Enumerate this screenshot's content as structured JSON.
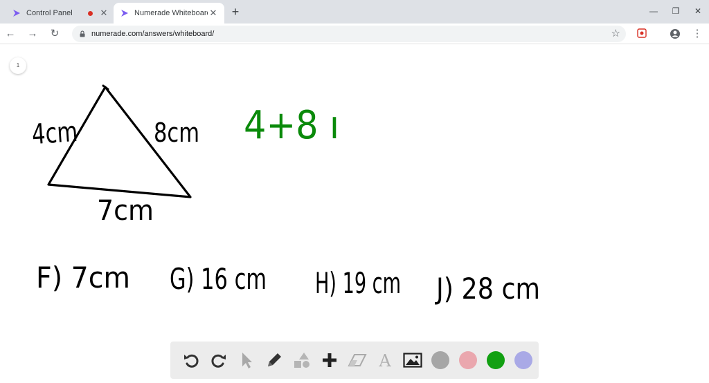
{
  "browser": {
    "tabs": [
      {
        "title": "Control Panel",
        "recording": true
      },
      {
        "title": "Numerade Whiteboard",
        "active": true
      }
    ],
    "url": "numerade.com/answers/whiteboard/"
  },
  "whiteboard": {
    "page_number": "1",
    "triangle": {
      "side_labels": [
        "4cm",
        "8cm",
        "7cm"
      ]
    },
    "work": "4+8 ı",
    "choices": [
      "F) 7cm",
      "G) 16 cm",
      "H) 19 cm",
      "J) 28 cm"
    ],
    "ink_black": "#000000",
    "ink_green": "#0a8a0a"
  },
  "dock": {
    "tools": [
      "undo-icon",
      "redo-icon",
      "pointer-icon",
      "pencil-icon",
      "shapes-icon",
      "plus-icon",
      "eraser-icon",
      "text-icon",
      "image-icon"
    ],
    "colors": [
      "#a6a6a6",
      "#eaa7ae",
      "#12a012",
      "#a9a9e6"
    ]
  }
}
